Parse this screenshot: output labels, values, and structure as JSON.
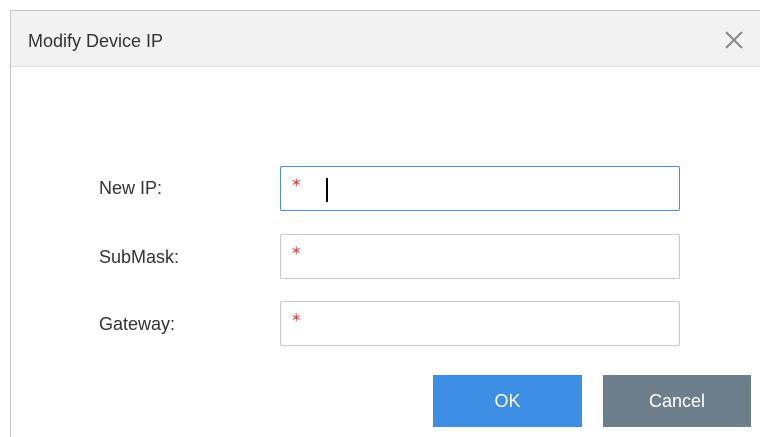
{
  "dialog": {
    "title": "Modify Device IP",
    "close_icon": "close-icon"
  },
  "form": {
    "fields": [
      {
        "label": "New IP:",
        "value": "",
        "required_mark": "*",
        "focused": true
      },
      {
        "label": "SubMask:",
        "value": "",
        "required_mark": "*",
        "focused": false
      },
      {
        "label": "Gateway:",
        "value": "",
        "required_mark": "*",
        "focused": false
      }
    ]
  },
  "buttons": {
    "ok_label": "OK",
    "cancel_label": "Cancel"
  },
  "colors": {
    "ok_button": "#3d8fe6",
    "cancel_button": "#6d7f8c",
    "required_mark": "#e8282d",
    "focus_border": "#4a90d9"
  }
}
